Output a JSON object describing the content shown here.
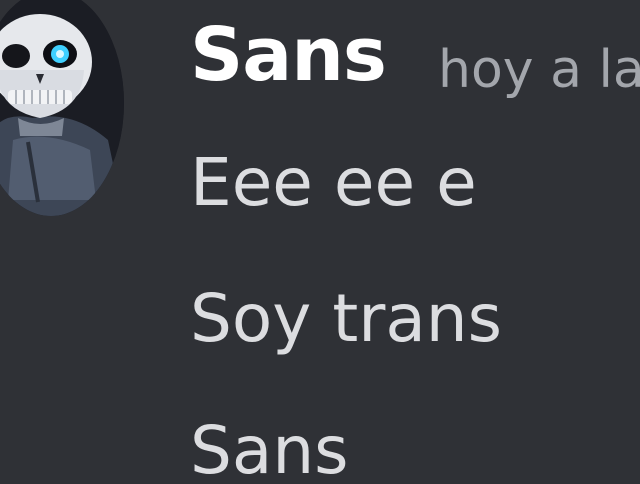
{
  "message": {
    "author": "Sans",
    "timestamp": "hoy a la",
    "avatar_icon": "sans-skeleton-avatar",
    "lines": [
      "Eee ee e",
      "Soy trans",
      "Sans"
    ]
  },
  "colors": {
    "background": "#2f3136",
    "username": "#ffffff",
    "timestamp": "#a3a6ac",
    "message_text": "#dcdde0",
    "eye_glow": "#3fd0ff"
  }
}
